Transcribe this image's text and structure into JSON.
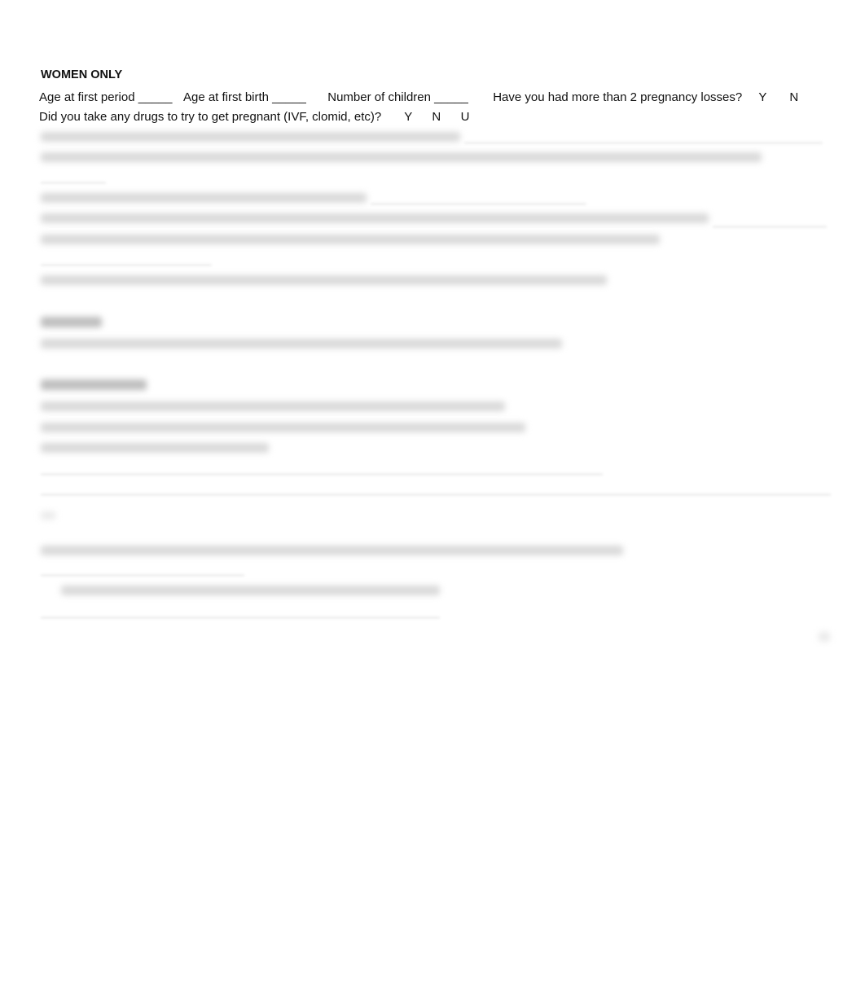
{
  "section": {
    "heading": "WOMEN ONLY",
    "row1": {
      "q1": "Age at first period _____",
      "q2": "Age at first birth _____",
      "q3": "Number of children _____",
      "q4": "Have you had more than 2 pregnancy losses?",
      "opt_y": "Y",
      "opt_n": "N"
    },
    "row2": {
      "q1": "Did you take any drugs to try to get pregnant (IVF, clomid, etc)?",
      "opt_y": "Y",
      "opt_n": "N",
      "opt_u": "U"
    }
  },
  "blurred_content_note": ""
}
